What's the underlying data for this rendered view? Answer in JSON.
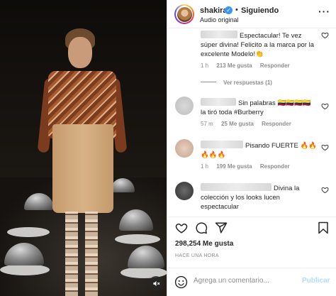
{
  "header": {
    "username": "shakira",
    "separator": "•",
    "follow_status": "Siguiendo",
    "audio": "Audio original",
    "more": "···"
  },
  "comments": [
    {
      "text": "Espectacular! Te vez súper divina! Felicito a la marca por la excelente Modelo!👏",
      "time": "1 h",
      "likes": "213 Me gusta",
      "reply": "Responder",
      "view_replies": "Ver respuestas (1)"
    },
    {
      "text": "Sin palabras 🇨🇴🇨🇴🇨🇴🇨🇴 la tiró toda #Burberry",
      "time": "57 m",
      "likes": "25 Me gusta",
      "reply": "Responder"
    },
    {
      "text": "Pisando FUERTE 🔥🔥🔥🔥🔥",
      "time": "1 h",
      "likes": "199 Me gusta",
      "reply": "Responder"
    },
    {
      "text": "Divina la colección y los looks lucen espectacular",
      "time": "",
      "likes": "",
      "reply": ""
    }
  ],
  "actions": {
    "likes": "298,254 Me gusta",
    "posted": "HACE UNA HORA"
  },
  "add_comment": {
    "placeholder": "Agrega un comentario...",
    "post": "Publicar"
  },
  "icons": {
    "header": [
      "verified-badge-icon",
      "more-options-icon"
    ],
    "comment": [
      "heart-outline-icon"
    ],
    "actions": [
      "heart-icon",
      "comment-icon",
      "share-icon",
      "save-bookmark-icon"
    ],
    "composer": [
      "emoji-icon"
    ],
    "media": [
      "mute-icon"
    ]
  }
}
